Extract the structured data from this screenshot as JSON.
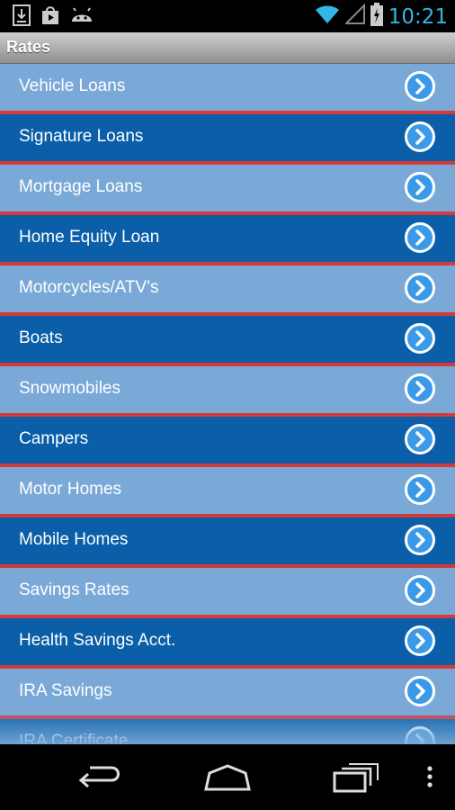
{
  "status_bar": {
    "time": "10:21",
    "left_icons": [
      "download-icon",
      "play-store-icon",
      "android-icon"
    ],
    "right_icons": [
      "wifi-icon",
      "signal-icon",
      "battery-charging-icon"
    ]
  },
  "title_bar": {
    "title": "Rates"
  },
  "colors": {
    "row_light": "#7aa9d8",
    "row_dark": "#0b5ea8",
    "separator": "#d43a3a",
    "accent": "#33b5e5"
  },
  "list": {
    "items": [
      {
        "label": "Vehicle Loans"
      },
      {
        "label": "Signature Loans"
      },
      {
        "label": "Mortgage Loans"
      },
      {
        "label": "Home Equity Loan"
      },
      {
        "label": "Motorcycles/ATV’s"
      },
      {
        "label": "Boats"
      },
      {
        "label": "Snowmobiles"
      },
      {
        "label": "Campers"
      },
      {
        "label": "Motor Homes"
      },
      {
        "label": "Mobile Homes"
      },
      {
        "label": "Savings Rates"
      },
      {
        "label": "Health Savings Acct."
      },
      {
        "label": "IRA Savings"
      },
      {
        "label": "IRA Certificate"
      }
    ]
  },
  "nav_bar": {
    "buttons": [
      "back-icon",
      "home-icon",
      "recent-apps-icon",
      "menu-icon"
    ]
  }
}
